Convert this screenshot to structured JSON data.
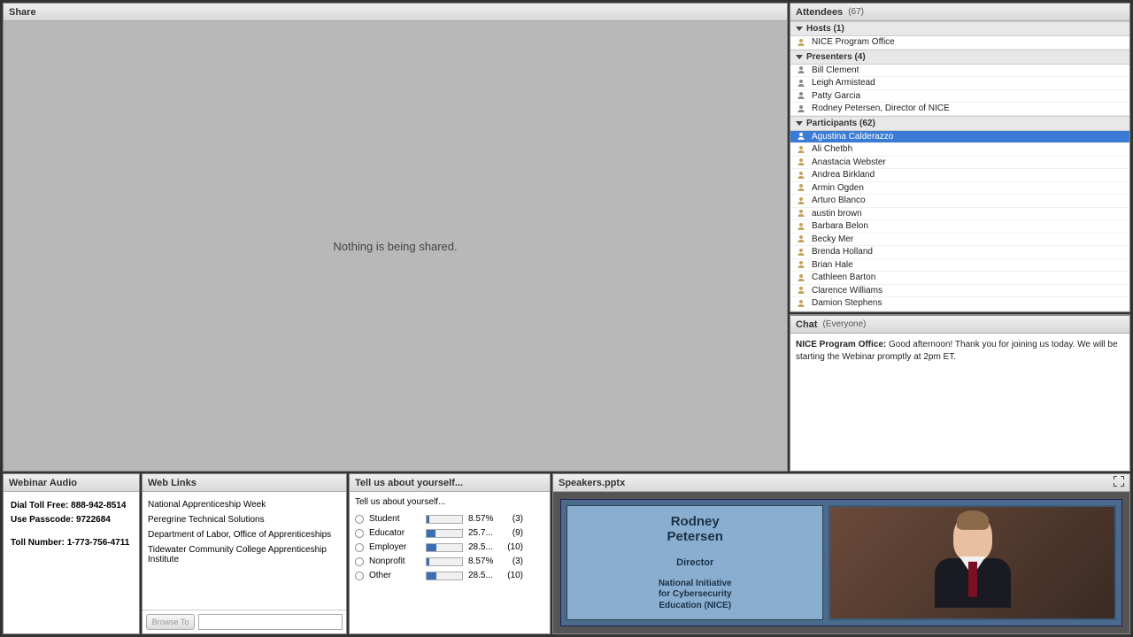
{
  "share": {
    "title": "Share",
    "message": "Nothing is being shared."
  },
  "attendees": {
    "title": "Attendees",
    "count": "(67)",
    "sections": [
      {
        "label": "Hosts (1)",
        "role": "host",
        "people": [
          "NICE Program Office"
        ]
      },
      {
        "label": "Presenters (4)",
        "role": "presenter",
        "people": [
          "Bill Clement",
          "Leigh Armistead",
          "Patty Garcia",
          "Rodney Petersen, Director of NICE"
        ]
      },
      {
        "label": "Participants (62)",
        "role": "participant",
        "people": [
          "Agustina Calderazzo",
          "Ali Chetbh",
          "Anastacia Webster",
          "Andrea Birkland",
          "Armin Ogden",
          "Arturo Blanco",
          "austin brown",
          "Barbara Belon",
          "Becky Mer",
          "Brenda Holland",
          "Brian Hale",
          "Cathleen Barton",
          "Clarence Williams",
          "Damion Stephens"
        ]
      }
    ],
    "selected": "Agustina Calderazzo"
  },
  "chat": {
    "title": "Chat",
    "scope": "(Everyone)",
    "messages": [
      {
        "sender": "NICE Program Office:",
        "text": "Good afternoon! Thank you for joining us today. We will be starting the Webinar promptly at 2pm ET."
      }
    ]
  },
  "audio": {
    "title": "Webinar Audio",
    "line1_label": "Dial Toll Free: ",
    "line1_value": "888-942-8514",
    "line2_label": "Use Passcode: ",
    "line2_value": "9722684",
    "line3_label": "Toll Number: ",
    "line3_value": "1-773-756-4711"
  },
  "links": {
    "title": "Web Links",
    "items": [
      "National Apprenticeship Week",
      "Peregrine Technical Solutions",
      "Department of Labor, Office of Apprenticeships",
      "Tidewater Community College Apprenticeship Institute"
    ],
    "button": "Browse To"
  },
  "poll": {
    "title": "Tell us about yourself...",
    "question": "Tell us about yourself...",
    "options": [
      {
        "label": "Student",
        "pct": "8.57%",
        "count": "(3)",
        "fill": 8.57
      },
      {
        "label": "Educator",
        "pct": "25.7...",
        "count": "(9)",
        "fill": 25.7
      },
      {
        "label": "Employer",
        "pct": "28.5...",
        "count": "(10)",
        "fill": 28.5
      },
      {
        "label": "Nonprofit",
        "pct": "8.57%",
        "count": "(3)",
        "fill": 8.57
      },
      {
        "label": "Other",
        "pct": "28.5...",
        "count": "(10)",
        "fill": 28.5
      }
    ]
  },
  "speakers": {
    "title": "Speakers.pptx",
    "slide": {
      "name1": "Rodney",
      "name2": "Petersen",
      "role": "Director",
      "org1": "National Initiative",
      "org2": "for Cybersecurity",
      "org3": "Education (NICE)"
    }
  }
}
